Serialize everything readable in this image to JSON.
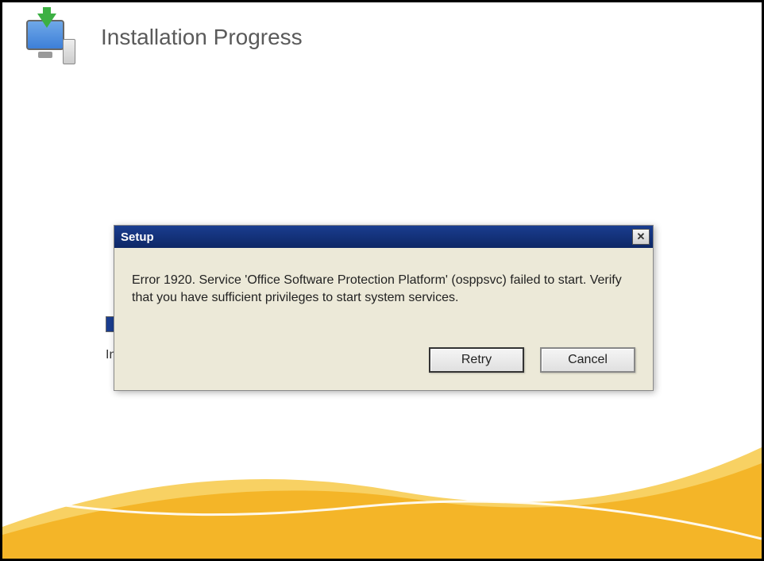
{
  "page": {
    "title": "Installation Progress",
    "status_prefix": "In"
  },
  "dialog": {
    "title": "Setup",
    "message": "Error 1920. Service 'Office Software Protection Platform' (osppsvc) failed to start.  Verify that you have sufficient privileges to start system services.",
    "retry_label": "Retry",
    "cancel_label": "Cancel",
    "close_label": "✕"
  }
}
